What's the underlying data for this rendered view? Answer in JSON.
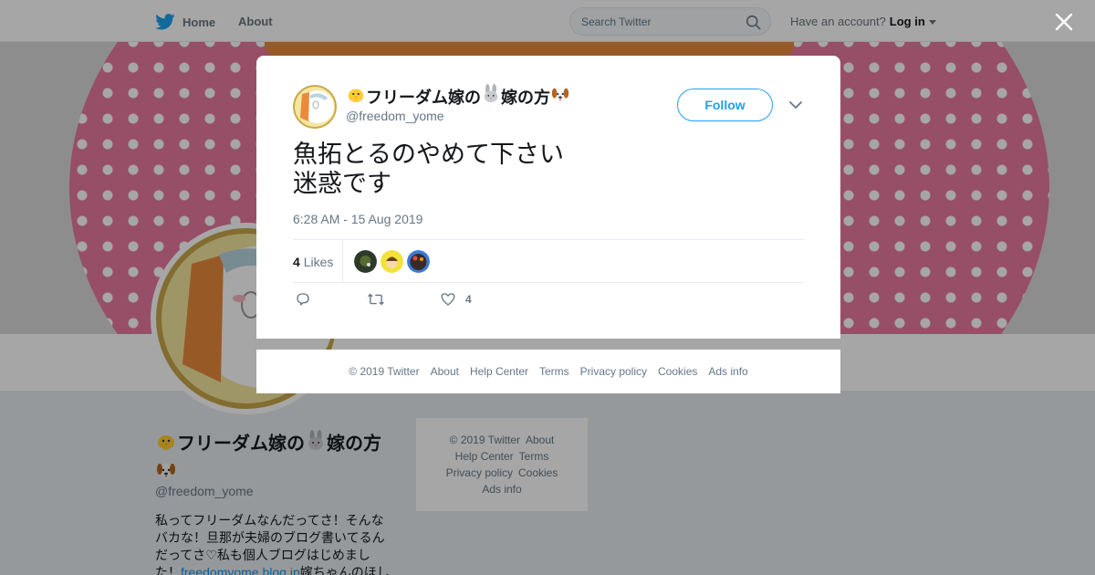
{
  "nav": {
    "home_label": "Home",
    "about_label": "About",
    "search_placeholder": "Search Twitter",
    "account_prompt": "Have an account?",
    "login_label": "Log in"
  },
  "profile": {
    "name_part1": "フリーダム嫁の",
    "name_part2": "嫁の方",
    "handle": "@freedom_yome",
    "bio_line1": "私ってフリーダムなんだってさ！そんな",
    "bio_line2": "バカな！旦那が夫婦のブログ書いてるん",
    "bio_line3": "だってさ♡私も個人ブログはじめまし",
    "bio_line4_prefix": "た！",
    "bio_link": "freedomyome.blog.jp",
    "bio_line4_suffix": "嫁ちゃんのほし"
  },
  "background_footer": {
    "copyright": "© 2019 Twitter",
    "about": "About",
    "help": "Help Center",
    "terms": "Terms",
    "privacy": "Privacy policy",
    "cookies": "Cookies",
    "ads": "Ads info"
  },
  "tweet": {
    "name_part1": "フリーダム嫁の",
    "name_part2": "嫁の方",
    "handle": "@freedom_yome",
    "follow_label": "Follow",
    "text_line1": "魚拓とるのやめて下さい",
    "text_line2": "迷惑です",
    "timestamp": "6:28 AM - 15 Aug 2019",
    "likes_count": "4",
    "likes_label": "Likes",
    "like_action_count": "4",
    "liker_colors": [
      "#2d3a2a",
      "#f2e23a",
      "#3a2a2a"
    ]
  },
  "modal_footer": {
    "copyright": "© 2019 Twitter",
    "about": "About",
    "help": "Help Center",
    "terms": "Terms",
    "privacy": "Privacy policy",
    "cookies": "Cookies",
    "ads": "Ads info"
  },
  "colors": {
    "twitter_blue": "#1da1f2",
    "banner_pink": "#e9789f",
    "hair_orange": "#e98a3c"
  },
  "icons": [
    "twitter-bird-icon",
    "search-icon",
    "caret-down-icon",
    "close-icon",
    "chevron-down-icon",
    "reply-icon",
    "retweet-icon",
    "heart-icon",
    "chick-emoji-icon",
    "rabbit-emoji-icon",
    "dog-emoji-icon"
  ]
}
